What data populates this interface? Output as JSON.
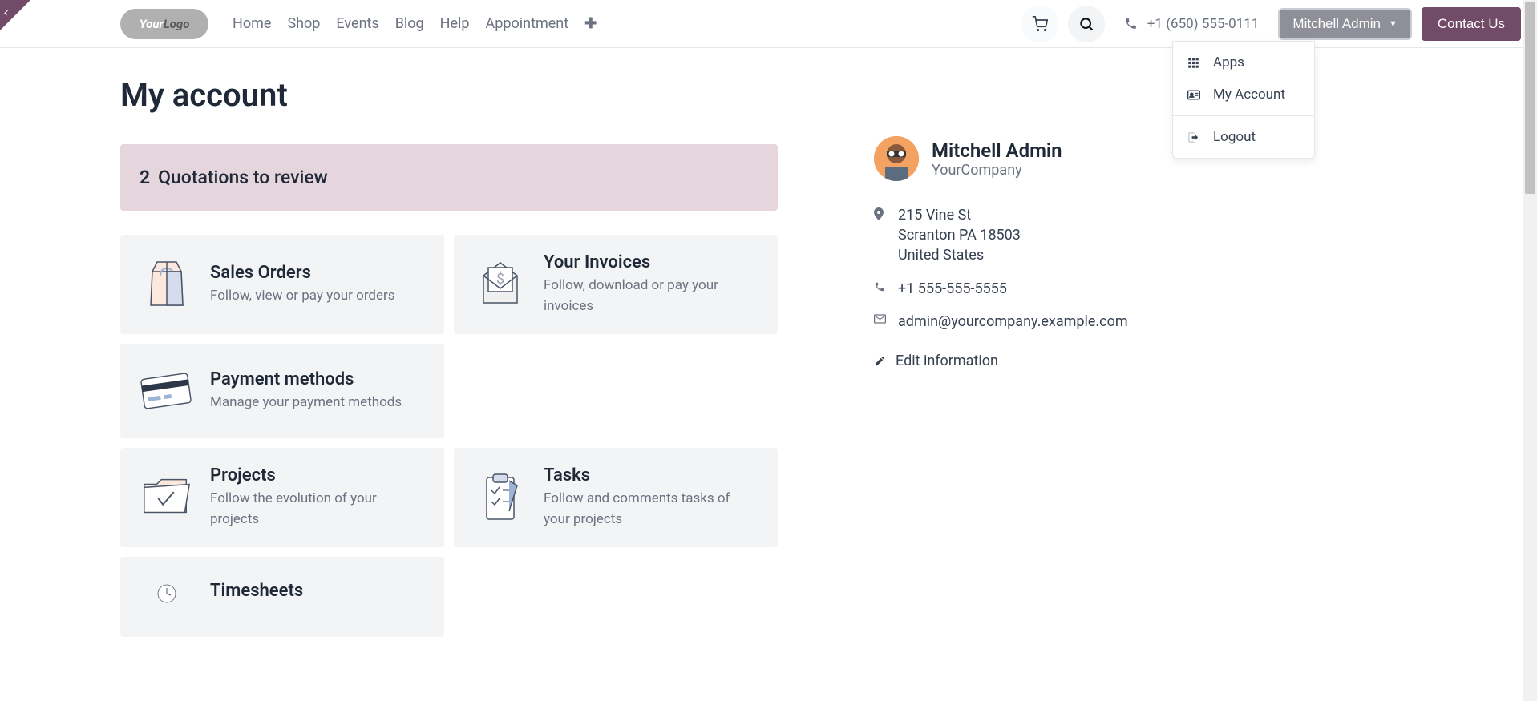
{
  "logo": {
    "part1": "Your",
    "part2": "Logo"
  },
  "nav": {
    "items": [
      "Home",
      "Shop",
      "Events",
      "Blog",
      "Help",
      "Appointment"
    ]
  },
  "header": {
    "phone": "+1 (650) 555-0111",
    "user": "Mitchell Admin",
    "contact_btn": "Contact Us"
  },
  "dropdown": {
    "apps": "Apps",
    "account": "My Account",
    "logout": "Logout"
  },
  "page_title": "My account",
  "alert": {
    "count": "2",
    "text": "Quotations to review"
  },
  "cards": {
    "sales": {
      "title": "Sales Orders",
      "desc": "Follow, view or pay your orders"
    },
    "invoices": {
      "title": "Your Invoices",
      "desc": "Follow, download or pay your invoices"
    },
    "payment": {
      "title": "Payment methods",
      "desc": "Manage your payment methods"
    },
    "projects": {
      "title": "Projects",
      "desc": "Follow the evolution of your projects"
    },
    "tasks": {
      "title": "Tasks",
      "desc": "Follow and comments tasks of your projects"
    },
    "timesheets": {
      "title": "Timesheets",
      "desc": ""
    }
  },
  "profile": {
    "name": "Mitchell Admin",
    "company": "YourCompany",
    "address_line1": "215 Vine St",
    "address_line2": "Scranton PA 18503",
    "address_line3": "United States",
    "phone": "+1 555-555-5555",
    "email": "admin@yourcompany.example.com",
    "edit": "Edit information"
  }
}
